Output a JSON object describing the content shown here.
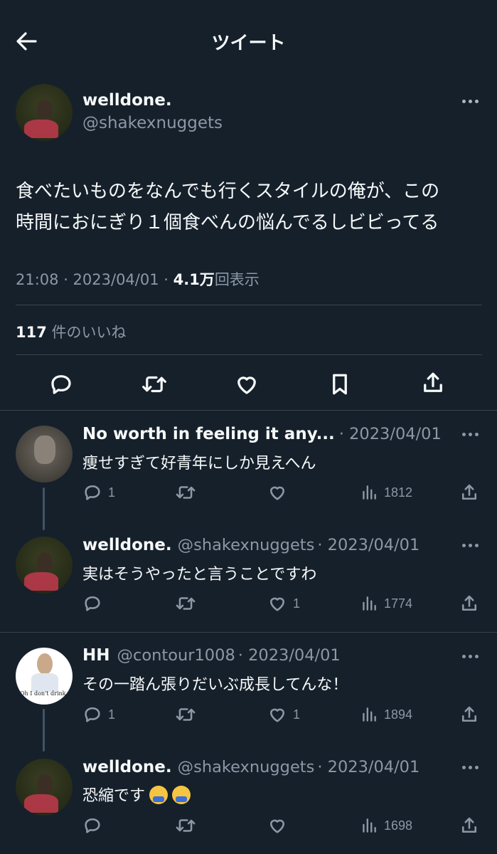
{
  "header": {
    "title": "ツイート"
  },
  "tweet": {
    "display_name": "welldone.",
    "handle": "@shakexnuggets",
    "text_line1": "食べたいものをなんでも行くスタイルの俺が、この",
    "text_line2": "時間におにぎり１個食べんの悩んでるしビビってる",
    "time": "21:08 · 2023/04/01 · ",
    "views_count": "4.1万",
    "views_label": "回表示",
    "likes_count": "117",
    "likes_label": " 件のいいね"
  },
  "replies": [
    {
      "name": "No worth in feeling it any...",
      "handle": "",
      "date": "· 2023/04/01",
      "text": "痩せすぎて好青年にしか見えへん",
      "replies": "1",
      "retweets": "",
      "likes": "",
      "views": "1812"
    },
    {
      "name": "welldone.",
      "handle": "@shakexnuggets",
      "date": "· 2023/04/01",
      "text": "実はそうやったと言うことですわ",
      "replies": "",
      "retweets": "",
      "likes": "1",
      "views": "1774"
    },
    {
      "name": "HH",
      "handle": "@contour1008",
      "date": "· 2023/04/01",
      "text": "その一踏ん張りだいぶ成長してんな！",
      "replies": "1",
      "retweets": "",
      "likes": "1",
      "views": "1894",
      "avatar_caption": "Oh I don't drink, drugs for me th"
    },
    {
      "name": "welldone.",
      "handle": "@shakexnuggets",
      "date": "· 2023/04/01",
      "text": "恐縮です",
      "replies": "",
      "retweets": "",
      "likes": "",
      "views": "1698"
    }
  ],
  "icons": [
    "back-arrow-icon",
    "more-icon",
    "reply-icon",
    "retweet-icon",
    "like-icon",
    "bookmark-icon",
    "share-icon",
    "views-icon",
    "bowing-emoji-icon"
  ],
  "colors": {
    "background": "#15202b",
    "text": "#f7f9f9",
    "muted": "#8b98a5",
    "divider": "#38444d"
  }
}
